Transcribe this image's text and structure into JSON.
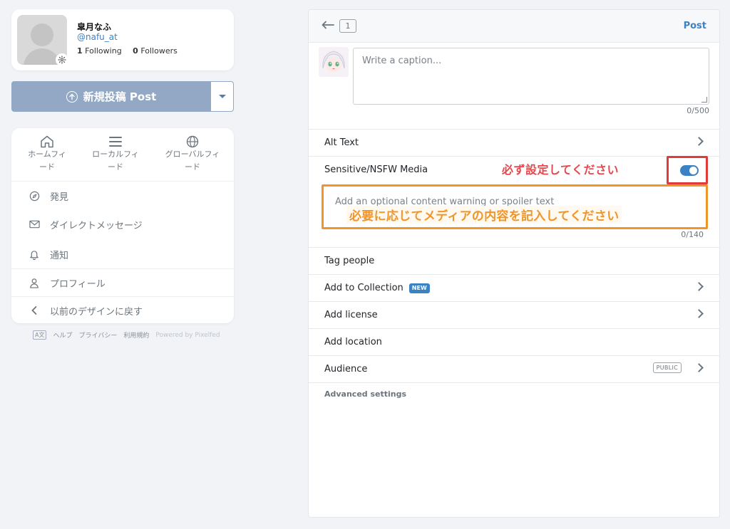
{
  "profile": {
    "name": "皐月なふ",
    "handle": "@nafu_at",
    "following_count": "1",
    "following_label": "Following",
    "followers_count": "0",
    "followers_label": "Followers"
  },
  "new_post_button": {
    "label": "新規投稿 Post",
    "icon": "arrow-up-circle-icon",
    "dropdown_icon": "caret-down-icon"
  },
  "nav": {
    "feeds": [
      {
        "label_line1": "ホームフィ",
        "label_line2": "ード",
        "icon": "home-icon"
      },
      {
        "label_line1": "ローカルフィ",
        "label_line2": "ード",
        "icon": "list-icon"
      },
      {
        "label_line1": "グローバルフィ",
        "label_line2": "ード",
        "icon": "globe-icon"
      }
    ],
    "items": [
      {
        "label": "発見",
        "icon": "compass-icon"
      },
      {
        "label": "ダイレクトメッセージ",
        "icon": "envelope-icon"
      },
      {
        "label": "通知",
        "icon": "bell-icon"
      },
      {
        "label": "プロフィール",
        "icon": "user-icon"
      },
      {
        "label": "以前のデザインに戻す",
        "icon": "chevron-left-icon"
      }
    ]
  },
  "footer": {
    "lang_label": "A文",
    "links": [
      "ヘルプ",
      "プライバシー",
      "利用規約"
    ],
    "powered": "Powered by Pixelfed"
  },
  "compose": {
    "page_number": "1",
    "post_label": "Post",
    "caption_placeholder": "Write a caption...",
    "caption_count": "0/500",
    "rows": {
      "alt_text": "Alt Text",
      "sensitive": "Sensitive/NSFW Media",
      "tag_people": "Tag people",
      "add_collection": "Add to Collection",
      "new_badge": "NEW",
      "add_license": "Add license",
      "add_location": "Add location",
      "audience": "Audience",
      "public_badge": "PUBLIC"
    },
    "sensitive_toggle_on": true,
    "cw_placeholder": "Add an optional content warning or spoiler text",
    "cw_count": "0/140",
    "advanced_settings": "Advanced settings"
  },
  "annotations": {
    "toggle_note": "必ず設定してください",
    "cw_note": "必要に応じてメディアの内容を記入してください",
    "red": "#e03a3a",
    "orange": "#f0952a"
  },
  "colors": {
    "accent": "#3b82c4",
    "post_button": "#92a8c4",
    "background": "#f1f3f6"
  }
}
